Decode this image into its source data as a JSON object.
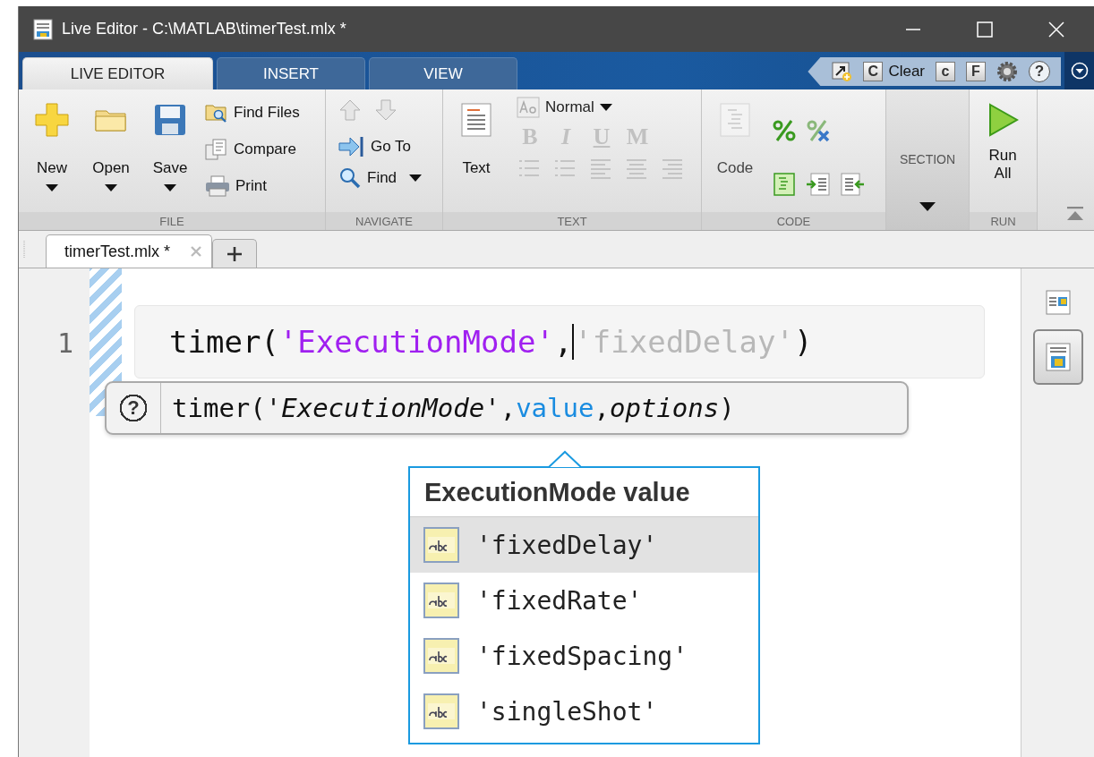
{
  "window": {
    "title": "Live Editor - C:\\MATLAB\\timerTest.mlx *"
  },
  "ribbon_tabs": [
    {
      "label": "LIVE EDITOR",
      "selected": true
    },
    {
      "label": "INSERT",
      "selected": false
    },
    {
      "label": "VIEW",
      "selected": false
    }
  ],
  "quick_access": [
    {
      "kind": "shortcut"
    },
    {
      "kind": "letter",
      "glyph": "C"
    },
    {
      "kind": "label",
      "label": "Clear"
    },
    {
      "kind": "letter",
      "glyph": "c"
    },
    {
      "kind": "letter",
      "glyph": "F"
    },
    {
      "kind": "settings"
    },
    {
      "kind": "help",
      "glyph": "?"
    }
  ],
  "ribbon_groups": [
    {
      "kind": "file",
      "label": "FILE",
      "large": [
        {
          "label": "New"
        },
        {
          "label": "Open"
        },
        {
          "label": "Save"
        }
      ],
      "small": [
        {
          "label": "Find Files"
        },
        {
          "label": "Compare"
        },
        {
          "label": "Print"
        }
      ]
    },
    {
      "kind": "navigate",
      "label": "NAVIGATE",
      "arrows": [
        {
          "disabled": true
        },
        {
          "disabled": true
        }
      ],
      "small": [
        {
          "label": "Go To",
          "dropdown": false
        },
        {
          "label": "Find",
          "dropdown": true
        }
      ]
    },
    {
      "kind": "text",
      "label": "TEXT",
      "large": [
        {
          "label": "Text"
        }
      ],
      "style_value": "Normal",
      "formats": [
        {
          "glyph": "B",
          "disabled": true
        },
        {
          "glyph": "I",
          "disabled": true
        },
        {
          "glyph": "U",
          "disabled": true
        },
        {
          "glyph": "M",
          "disabled": true
        }
      ]
    },
    {
      "kind": "code",
      "label": "CODE",
      "large": [
        {
          "label": "Code",
          "disabled": true
        }
      ]
    },
    {
      "kind": "section",
      "label": "SECTION"
    },
    {
      "kind": "run",
      "label": "RUN",
      "large": [
        {
          "label": "Run All"
        }
      ]
    }
  ],
  "document_tabs": [
    {
      "label": "timerTest.mlx *",
      "selected": true
    }
  ],
  "editor": {
    "line_number": "1",
    "code_tokens": [
      {
        "kind": "plain",
        "text": "timer("
      },
      {
        "kind": "string",
        "text": "'ExecutionMode'"
      },
      {
        "kind": "plain",
        "text": ","
      },
      {
        "kind": "caret"
      },
      {
        "kind": "ghost",
        "text": "'fixedDelay'"
      },
      {
        "kind": "plain",
        "text": ")"
      }
    ],
    "hint": {
      "glyph": "?",
      "tokens": [
        {
          "kind": "plain",
          "text": "timer("
        },
        {
          "kind": "param",
          "text": "'ExecutionMode'"
        },
        {
          "kind": "plain",
          "text": ","
        },
        {
          "kind": "current",
          "text": "value"
        },
        {
          "kind": "plain",
          "text": ","
        },
        {
          "kind": "param",
          "text": "options"
        },
        {
          "kind": "plain",
          "text": ")"
        }
      ]
    },
    "completion": {
      "title": "ExecutionMode value",
      "items": [
        {
          "label": "'fixedDelay'",
          "selected": true
        },
        {
          "label": "'fixedRate'",
          "selected": false
        },
        {
          "label": "'fixedSpacing'",
          "selected": false
        },
        {
          "label": "'singleShot'",
          "selected": false
        }
      ]
    }
  },
  "view_buttons": [
    {
      "selected": false
    },
    {
      "selected": true
    }
  ]
}
